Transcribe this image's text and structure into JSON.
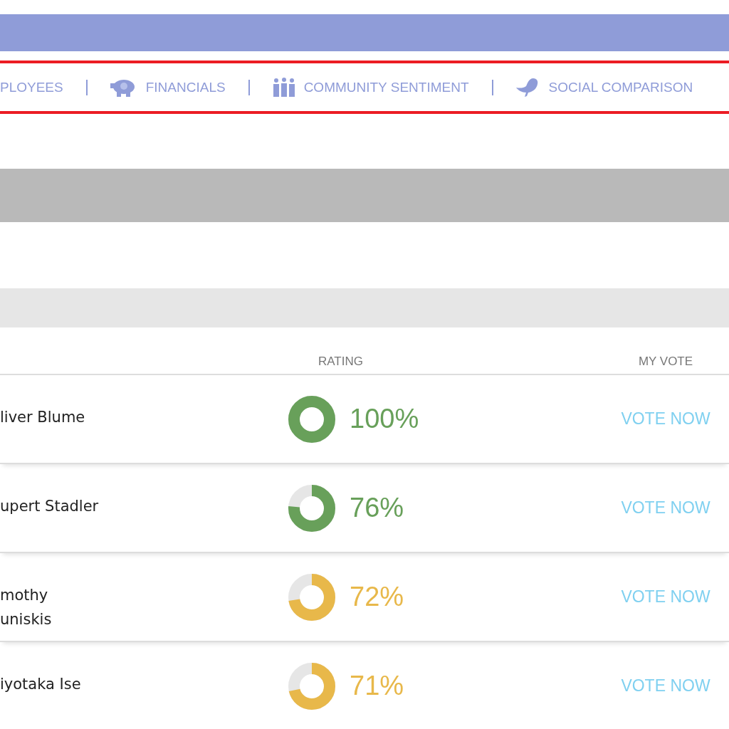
{
  "nav": {
    "items": [
      {
        "label": "PLOYEES"
      },
      {
        "label": "FINANCIALS"
      },
      {
        "label": "COMMUNITY SENTIMENT"
      },
      {
        "label": "SOCIAL COMPARISON"
      }
    ]
  },
  "table": {
    "columns": [
      "RATING",
      "MY VOTE"
    ],
    "rows": [
      {
        "name": "liver Blume",
        "level": 1.0,
        "color": "#68a05a",
        "rating": "100%",
        "vote": "VOTE NOW"
      },
      {
        "name": "upert Stadler",
        "level": 0.76,
        "color": "#68a05a",
        "rating": "76%",
        "vote": "VOTE NOW"
      },
      {
        "name": "mothy\nuniskis",
        "level": 0.72,
        "color": "#e8b84a",
        "rating": "72%",
        "vote": "VOTE NOW"
      },
      {
        "name": "iyotaka Ise",
        "level": 0.71,
        "color": "#e8b84a",
        "rating": "71%",
        "vote": "VOTE NOW"
      }
    ]
  }
}
